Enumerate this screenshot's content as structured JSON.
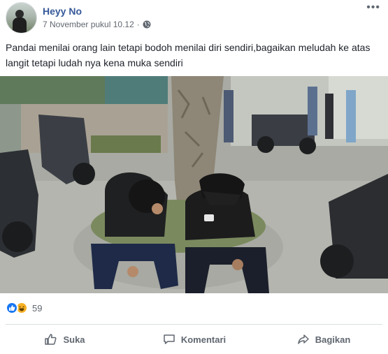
{
  "post": {
    "author": "Heyy No",
    "timestamp": "7 November pukul 10.12",
    "separator": "·",
    "privacy_icon": "globe-icon",
    "more_icon": "more-options-icon",
    "text": "Pandai menilai orang lain tetapi bodoh menilai diri sendiri,bagaikan meludah ke atas langit tetapi ludah nya kena muka sendiri",
    "photo_caption": "",
    "reactions": {
      "types": [
        "like",
        "haha"
      ],
      "count": "59"
    },
    "actions": [
      {
        "label": "Suka",
        "icon": "thumbs-up-icon"
      },
      {
        "label": "Komentari",
        "icon": "comment-icon"
      },
      {
        "label": "Bagikan",
        "icon": "share-icon"
      }
    ]
  },
  "colors": {
    "author_link": "#365899",
    "meta_text": "#616770",
    "like_blue": "#1877f2",
    "haha_yellow": "#f7b125"
  }
}
